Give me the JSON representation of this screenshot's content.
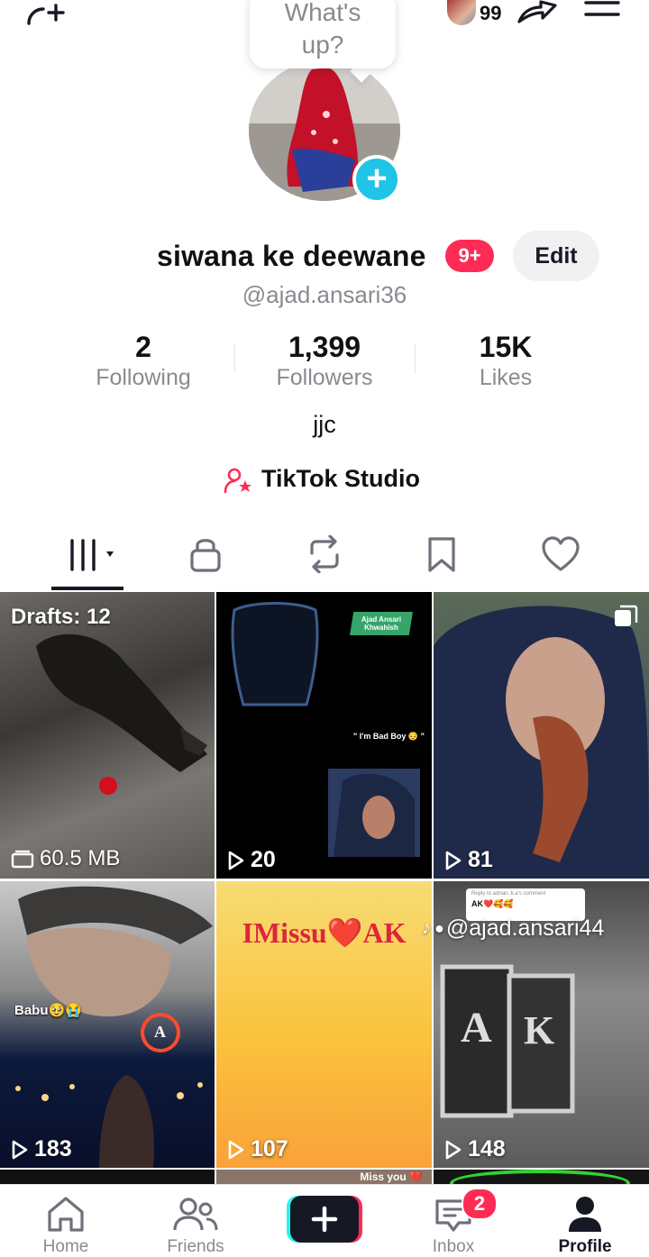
{
  "top_bar": {
    "add_friend_icon": "person-plus-icon",
    "story_count": "99",
    "share_icon": "share-arrow-icon",
    "menu_icon": "hamburger-menu-icon"
  },
  "status_bubble": {
    "text": "What's up?"
  },
  "profile": {
    "display_name": "siwana ke deewane",
    "notif_badge": "9+",
    "edit_label": "Edit",
    "handle": "@ajad.ansari36",
    "bio": "jjc",
    "studio_label": "TikTok Studio"
  },
  "stats": [
    {
      "value": "2",
      "label": "Following"
    },
    {
      "value": "1,399",
      "label": "Followers"
    },
    {
      "value": "15K",
      "label": "Likes"
    }
  ],
  "tabs": [
    "videos-grid-icon",
    "lock-icon",
    "repost-icon",
    "bookmark-icon",
    "heart-icon"
  ],
  "grid": {
    "drafts_label": "Drafts: 12",
    "drafts_size": "60.5 MB",
    "cells": [
      {
        "views": "20",
        "overlay_badge": "Ajad Ansari Khwahish",
        "overlay_quote": "\" I'm Bad Boy 😔 \""
      },
      {
        "views": "81"
      },
      {
        "views": "183",
        "overlay_text": "Babu🥹😭",
        "overlay_letter": "A"
      },
      {
        "views": "107",
        "overlay_text": "IMissu❤️AK"
      },
      {
        "views": "148",
        "reply_header": "Reply to adnan..k.a's comment",
        "reply_text": "AK❤️🥰🥰",
        "watermark": "@ajad.ansari44",
        "letters": [
          "A",
          "K"
        ]
      }
    ],
    "partial_row_text": "Miss you 💔"
  },
  "bottom_nav": {
    "items": [
      {
        "label": "Home",
        "icon": "home-icon"
      },
      {
        "label": "Friends",
        "icon": "friends-icon"
      },
      {
        "label": "",
        "icon": "create-plus-icon"
      },
      {
        "label": "Inbox",
        "icon": "inbox-icon"
      },
      {
        "label": "Profile",
        "icon": "profile-icon"
      }
    ],
    "inbox_badge": "2"
  }
}
